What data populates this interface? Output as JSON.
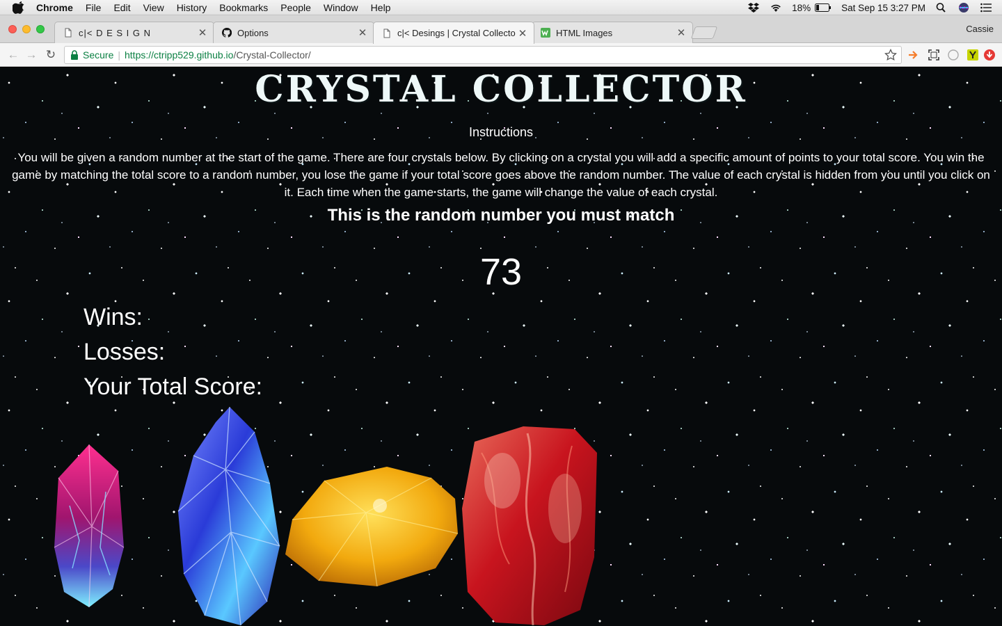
{
  "menubar": {
    "app_name": "Chrome",
    "items": [
      "File",
      "Edit",
      "View",
      "History",
      "Bookmarks",
      "People",
      "Window",
      "Help"
    ],
    "battery": "18%",
    "datetime": "Sat Sep 15  3:27 PM"
  },
  "tabs": [
    {
      "title": "c|< D E S I G N",
      "icon": "document-icon"
    },
    {
      "title": "Options",
      "icon": "github-icon"
    },
    {
      "title": "c|< Desings | Crystal Collector",
      "icon": "document-icon",
      "active": true
    },
    {
      "title": "HTML Images",
      "icon": "w3schools-icon"
    }
  ],
  "profile_name": "Cassie",
  "omnibox": {
    "secure_label": "Secure",
    "url_host": "https://ctripp529.github.io",
    "url_path": "/Crystal-Collector/"
  },
  "page": {
    "title": "Crystal Collector",
    "instructions_heading": "Instructions",
    "instructions_body": "You will be given a random number at the start of the game. There are four crystals below. By clicking on a crystal you will add a specific amount of points to your total score. You win the game by matching the total score to a random number, you lose the game if your total score goes above the random number. The value of each crystal is hidden from you until you click on it. Each time when the game starts, the game will change the value of each crystal.",
    "match_heading": "This is the random number you must match",
    "random_number": "73",
    "wins_label": "Wins:",
    "losses_label": "Losses:",
    "total_label": "Your Total Score:",
    "crystals": [
      "pink-crystal",
      "blue-crystal",
      "yellow-crystal",
      "red-crystal"
    ]
  },
  "colors": {
    "page_background": "#070a0c",
    "title_text": "#eef8f8",
    "secure_green": "#0b8043"
  }
}
